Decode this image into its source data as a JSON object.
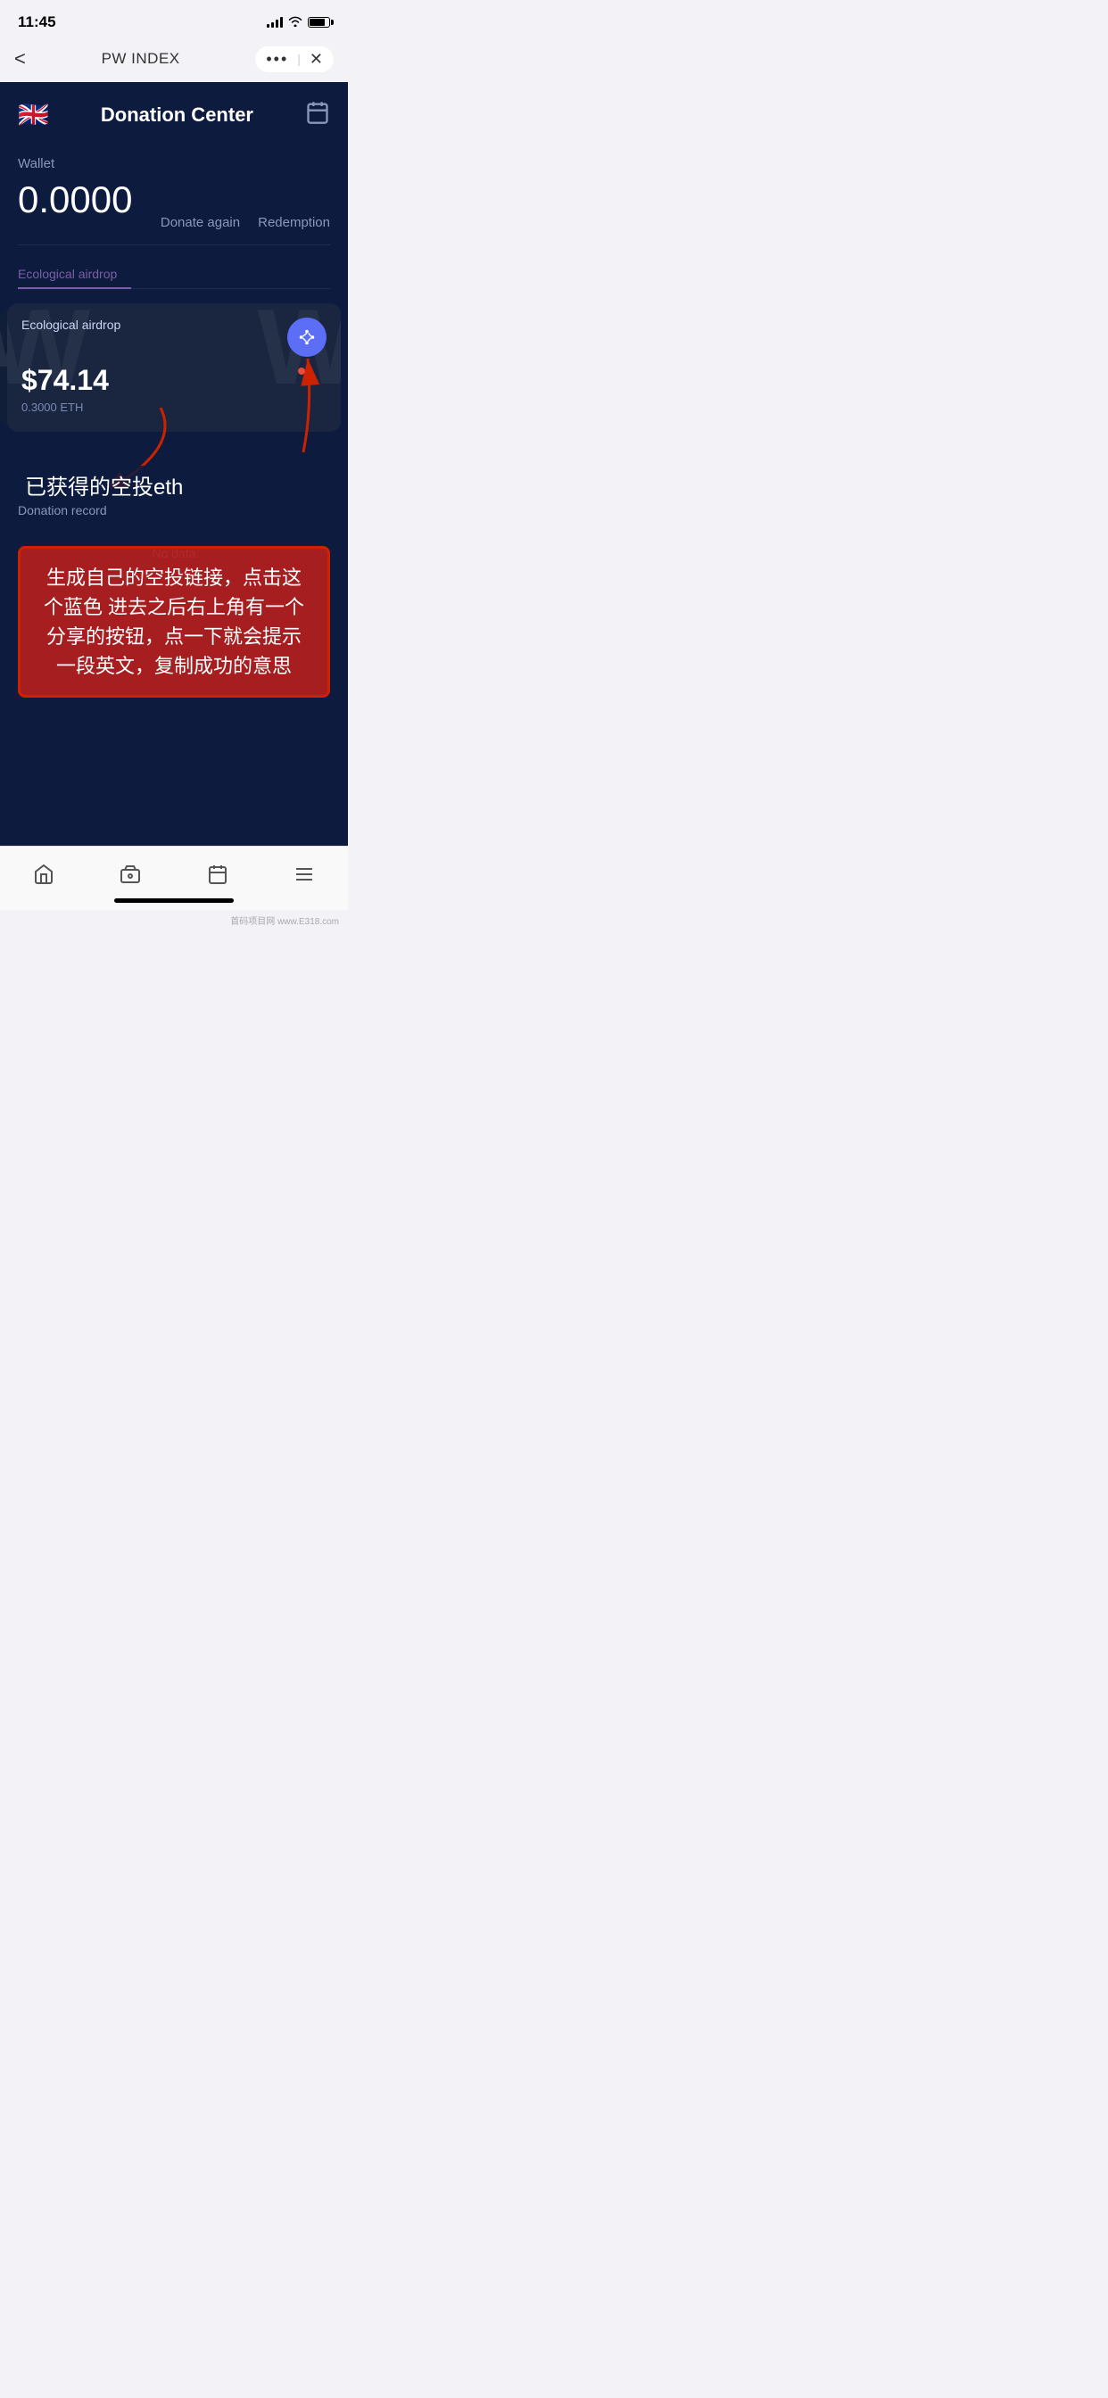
{
  "statusBar": {
    "time": "11:45"
  },
  "navBar": {
    "title": "PW INDEX",
    "backLabel": "<",
    "dotsLabel": "•••",
    "closeLabel": "✕"
  },
  "header": {
    "flagEmoji": "🇬🇧",
    "title": "Donation Center"
  },
  "wallet": {
    "label": "Wallet",
    "amount": "0.0000",
    "donateAgainLabel": "Donate again",
    "redemptionLabel": "Redemption"
  },
  "tabs": [
    {
      "label": "Ecological airdrop",
      "active": true
    },
    {
      "label": "",
      "active": false
    }
  ],
  "airdropCard": {
    "label": "Ecological airdrop",
    "amount": "$74.14",
    "ethAmount": "0.3000 ETH",
    "btnIcon": "⊕"
  },
  "donationRecord": {
    "label": "Donation record",
    "noData": "No data"
  },
  "annotationText": "生成自己的空投链接，点击这个蓝色 进去之后右上角有一个分享的按钮，点一下就会提示一段英文，复制成功的意思",
  "airdropLabelOverlay": "已获得的空投eth",
  "bottomTabs": [
    {
      "icon": "🏠",
      "label": "home"
    },
    {
      "icon": "💼",
      "label": "wallet"
    },
    {
      "icon": "📅",
      "label": "calendar"
    },
    {
      "icon": "☰",
      "label": "menu"
    }
  ],
  "watermarkText": "W",
  "colors": {
    "background": "#0d1b3e",
    "cardBg": "#1a2540",
    "accent": "#5b6ef5",
    "textMuted": "#8899bb",
    "textWhite": "#ffffff",
    "arrowColor": "#cc2200"
  }
}
